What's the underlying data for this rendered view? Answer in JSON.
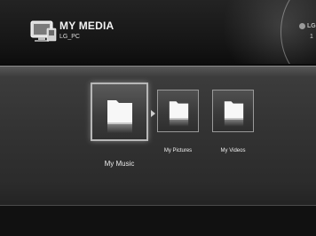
{
  "header": {
    "title": "MY MEDIA",
    "device": "LG_PC",
    "brand_logo": "LG",
    "brand_sub": "1"
  },
  "tiles": [
    {
      "label": "My Music",
      "icon": "folder-icon",
      "selected": true
    },
    {
      "label": "My Pictures",
      "icon": "folder-icon",
      "selected": false
    },
    {
      "label": "My Videos",
      "icon": "folder-icon",
      "selected": false
    }
  ],
  "colors": {
    "background": "#0b0b0b",
    "band": "#333333",
    "text": "#f0f0f0",
    "focus_border": "#b7b7b7"
  }
}
